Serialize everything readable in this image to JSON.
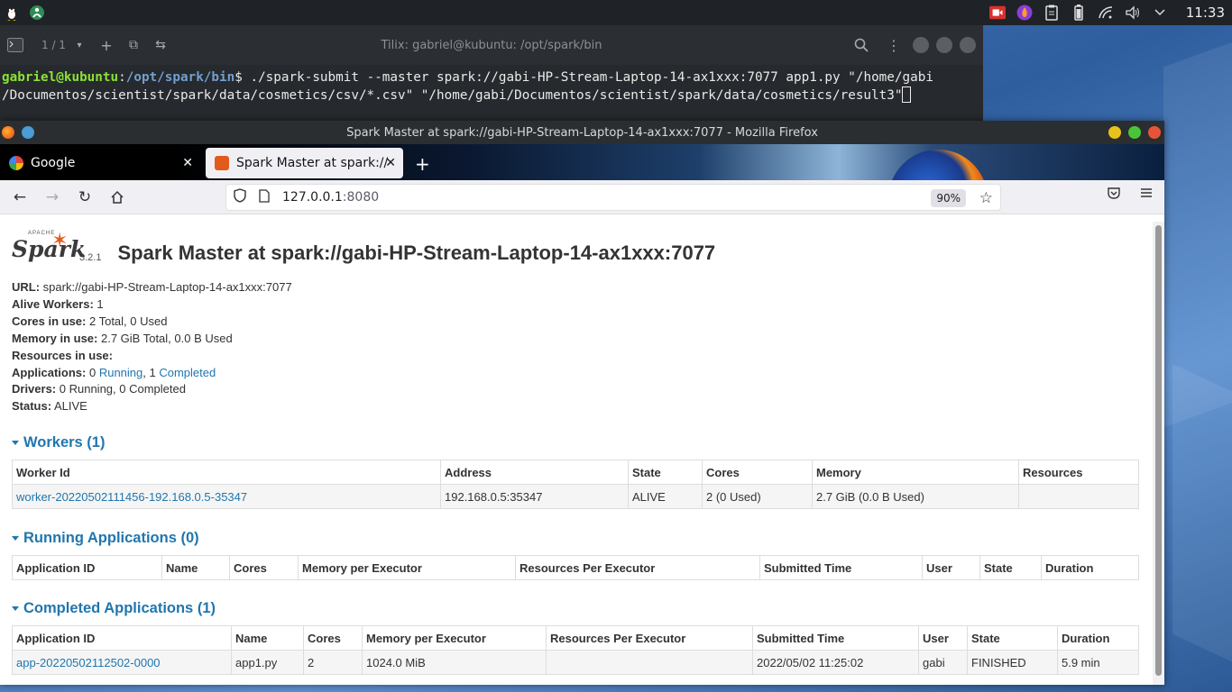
{
  "panel": {
    "clock": "11:33"
  },
  "terminal": {
    "tab_counter": "1 / 1",
    "title": "Tilix: gabriel@kubuntu: /opt/spark/bin",
    "prompt_user": "gabriel@kubuntu",
    "prompt_sep": ":",
    "prompt_path": "/opt/spark/bin",
    "prompt_end": "$ ",
    "command_line1": "./spark-submit --master spark://gabi-HP-Stream-Laptop-14-ax1xxx:7077 app1.py \"/home/gabi",
    "command_line2": "/Documentos/scientist/spark/data/cosmetics/csv/*.csv\" \"/home/gabi/Documentos/scientist/spark/data/cosmetics/result3\""
  },
  "browser": {
    "window_title": "Spark Master at spark://gabi-HP-Stream-Laptop-14-ax1xxx:7077 - Mozilla Firefox",
    "tabs": [
      {
        "label": "Google"
      },
      {
        "label": "Spark Master at spark://gabi-"
      }
    ],
    "url_host": "127.0.0.1",
    "url_port": ":8080",
    "zoom": "90%"
  },
  "page": {
    "version": "3.2.1",
    "title": "Spark Master at spark://gabi-HP-Stream-Laptop-14-ax1xxx:7077",
    "logo_text": "Spark",
    "logo_apache": "APACHE",
    "summary": {
      "url_label": "URL:",
      "url_value": "spark://gabi-HP-Stream-Laptop-14-ax1xxx:7077",
      "alive_label": "Alive Workers:",
      "alive_value": "1",
      "cores_label": "Cores in use:",
      "cores_value": "2 Total, 0 Used",
      "memory_label": "Memory in use:",
      "memory_value": "2.7 GiB Total, 0.0 B Used",
      "resources_label": "Resources in use:",
      "apps_label": "Applications:",
      "apps_running_count": "0",
      "apps_running_link": "Running",
      "apps_sep": ", 1",
      "apps_completed_link": "Completed",
      "drivers_label": "Drivers:",
      "drivers_value": "0 Running, 0 Completed",
      "status_label": "Status:",
      "status_value": "ALIVE"
    },
    "workers": {
      "heading": "Workers (1)",
      "columns": [
        "Worker Id",
        "Address",
        "State",
        "Cores",
        "Memory",
        "Resources"
      ],
      "rows": [
        [
          "worker-20220502111456-192.168.0.5-35347",
          "192.168.0.5:35347",
          "ALIVE",
          "2 (0 Used)",
          "2.7 GiB (0.0 B Used)",
          ""
        ]
      ]
    },
    "running": {
      "heading": "Running Applications (0)",
      "columns": [
        "Application ID",
        "Name",
        "Cores",
        "Memory per Executor",
        "Resources Per Executor",
        "Submitted Time",
        "User",
        "State",
        "Duration"
      ]
    },
    "completed": {
      "heading": "Completed Applications (1)",
      "columns": [
        "Application ID",
        "Name",
        "Cores",
        "Memory per Executor",
        "Resources Per Executor",
        "Submitted Time",
        "User",
        "State",
        "Duration"
      ],
      "rows": [
        [
          "app-20220502112502-0000",
          "app1.py",
          "2",
          "1024.0 MiB",
          "",
          "2022/05/02 11:25:02",
          "gabi",
          "FINISHED",
          "5.9 min"
        ]
      ]
    }
  }
}
